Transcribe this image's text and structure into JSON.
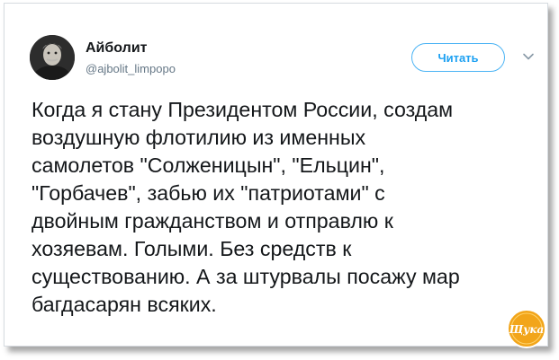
{
  "tweet": {
    "author_name": "Айболит",
    "author_handle": "@ajbolit_limpopo",
    "follow_label": "Читать",
    "text_lines": [
      "Когда я стану Президентом России, создам",
      "воздушную флотилию из именных",
      "самолетов \"Солженицын\", \"Ельцин\",",
      "\"Горбачев\", забью их \"патриотами\" с",
      "двойным гражданством и отправлю к",
      "хозяевам. Голыми. Без средств к",
      "существованию. А за штурвалы посажу мар",
      "багдасарян всяких."
    ]
  },
  "watermark": {
    "text": "Щука"
  },
  "colors": {
    "accent": "#1da1f2",
    "text": "#14171a",
    "muted": "#657786",
    "border": "#d6dbe0",
    "badge_orange": "#f2a51a"
  },
  "icons": {
    "menu": "chevron-down-icon",
    "avatar": "author-avatar"
  }
}
